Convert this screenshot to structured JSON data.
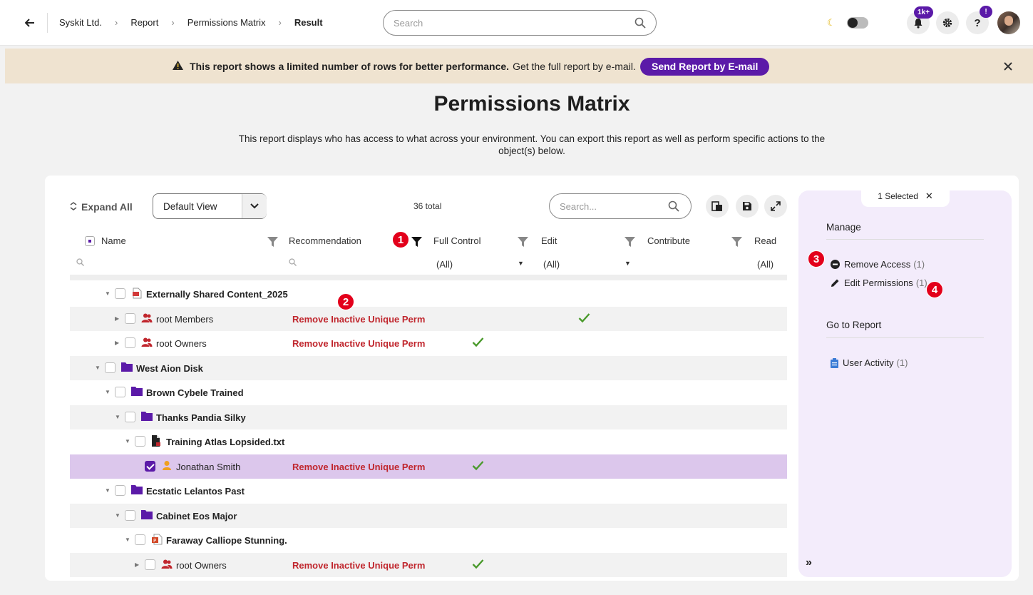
{
  "breadcrumbs": [
    "Syskit Ltd.",
    "Report",
    "Permissions Matrix",
    "Result"
  ],
  "top_search": {
    "placeholder": "Search"
  },
  "notifications_badge": "1k+",
  "help_badge": "!",
  "banner": {
    "bold": "This report shows a limited number of rows for better performance.",
    "text": "Get the full report by e-mail.",
    "button": "Send Report by E-mail"
  },
  "page": {
    "title": "Permissions Matrix",
    "description": "This report displays who has access to what across your environment. You can export this report as well as perform specific actions to the object(s) below."
  },
  "toolbar": {
    "expand_all": "Expand All",
    "view": "Default View",
    "total": "36 total",
    "search_placeholder": "Search..."
  },
  "columns": {
    "name": "Name",
    "recommendation": "Recommendation",
    "full_control": "Full Control",
    "edit": "Edit",
    "contribute": "Contribute",
    "read": "Read",
    "filter_all": "(All)"
  },
  "rows": [
    {
      "name": "Externally Shared Content_2025",
      "type": "file-pdf",
      "bold": true,
      "recommendation": "",
      "full_control": false,
      "edit": false,
      "selected": false
    },
    {
      "name": "root Members",
      "type": "group",
      "bold": false,
      "recommendation": "Remove Inactive Unique Perm",
      "full_control": false,
      "edit": true,
      "selected": false
    },
    {
      "name": "root Owners",
      "type": "group",
      "bold": false,
      "recommendation": "Remove Inactive Unique Perm",
      "full_control": true,
      "edit": false,
      "selected": false
    },
    {
      "name": "West Aion Disk",
      "type": "folder",
      "bold": true,
      "recommendation": "",
      "full_control": false,
      "edit": false,
      "selected": false
    },
    {
      "name": "Brown Cybele Trained",
      "type": "folder",
      "bold": true,
      "recommendation": "",
      "full_control": false,
      "edit": false,
      "selected": false
    },
    {
      "name": "Thanks Pandia Silky",
      "type": "folder",
      "bold": true,
      "recommendation": "",
      "full_control": false,
      "edit": false,
      "selected": false
    },
    {
      "name": "Training Atlas Lopsided.txt",
      "type": "file-txt",
      "bold": true,
      "recommendation": "",
      "full_control": false,
      "edit": false,
      "selected": false
    },
    {
      "name": "Jonathan Smith",
      "type": "user",
      "bold": false,
      "recommendation": "Remove Inactive Unique Perm",
      "full_control": true,
      "edit": false,
      "selected": true
    },
    {
      "name": "Ecstatic Lelantos Past",
      "type": "folder",
      "bold": true,
      "recommendation": "",
      "full_control": false,
      "edit": false,
      "selected": false
    },
    {
      "name": "Cabinet Eos Major",
      "type": "folder",
      "bold": true,
      "recommendation": "",
      "full_control": false,
      "edit": false,
      "selected": false
    },
    {
      "name": "Faraway Calliope Stunning.",
      "type": "file-ppt",
      "bold": true,
      "recommendation": "",
      "full_control": false,
      "edit": false,
      "selected": false
    },
    {
      "name": "root Owners",
      "type": "group",
      "bold": false,
      "recommendation": "Remove Inactive Unique Perm",
      "full_control": true,
      "edit": false,
      "selected": false
    }
  ],
  "side_panel": {
    "selected": "1 Selected",
    "manage_title": "Manage",
    "remove_access": "Remove Access",
    "remove_access_count": "(1)",
    "edit_permissions": "Edit Permissions",
    "edit_permissions_count": "(1)",
    "goto_title": "Go to Report",
    "user_activity": "User Activity",
    "user_activity_count": "(1)"
  },
  "markers": [
    "1",
    "2",
    "3",
    "4"
  ],
  "colors": {
    "accent": "#5b1aa8",
    "recommendation": "#c0262d",
    "check": "#4a9a2c",
    "marker": "#e3001b"
  }
}
